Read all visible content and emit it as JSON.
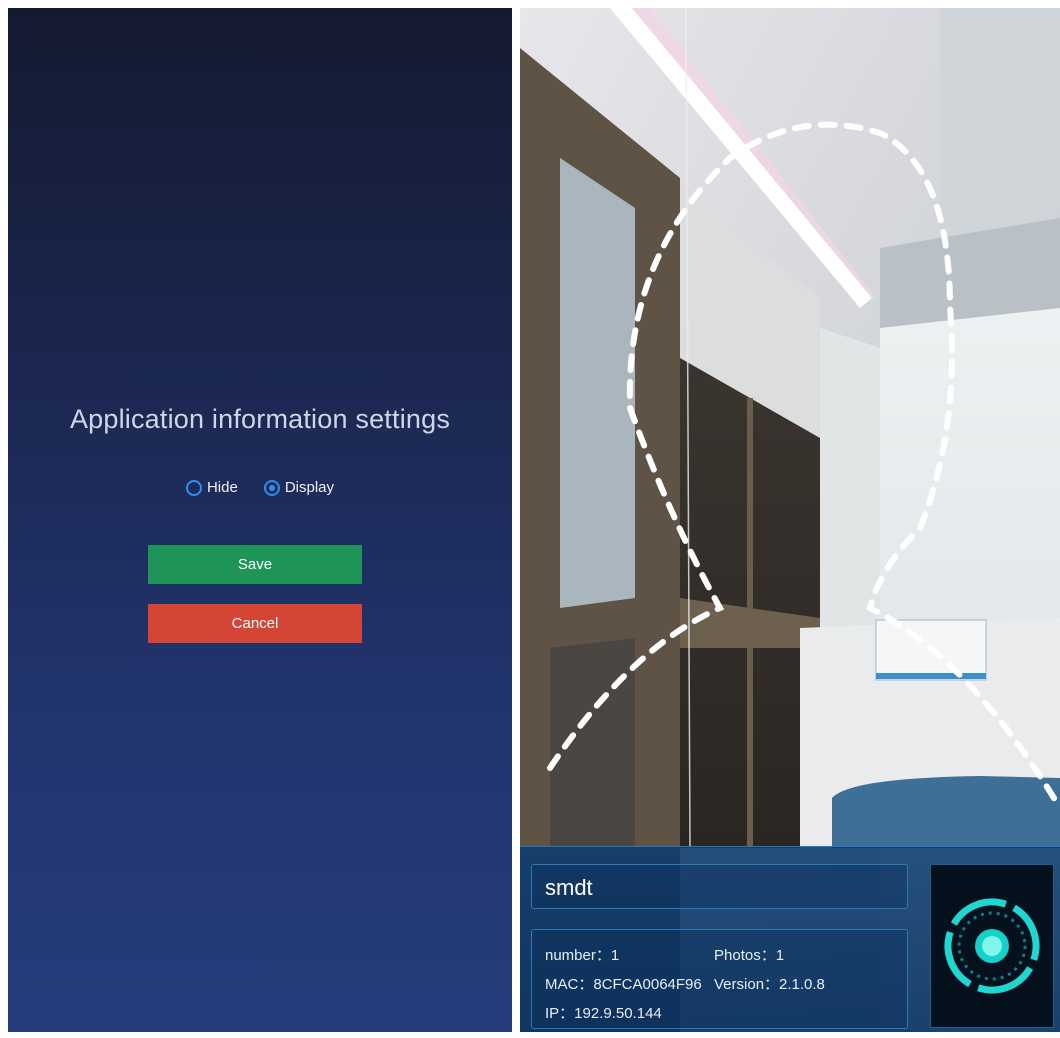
{
  "settings": {
    "title": "Application information settings",
    "options": [
      {
        "label": "Hide",
        "selected": false
      },
      {
        "label": "Display",
        "selected": true
      }
    ],
    "save_label": "Save",
    "cancel_label": "Cancel"
  },
  "device_info": {
    "name": "smdt",
    "number": "number：1",
    "photos": "Photos：1",
    "mac": "MAC：8CFCA0064F96",
    "version": "Version：2.1.0.8",
    "ip": "IP：192.9.50.144"
  },
  "colors": {
    "accent": "#2f8ff0",
    "save": "#1e9458",
    "cancel": "#d54535",
    "face_ring": "#1fd6d0"
  },
  "icons": {
    "face_scan": "face-recognition-icon"
  }
}
